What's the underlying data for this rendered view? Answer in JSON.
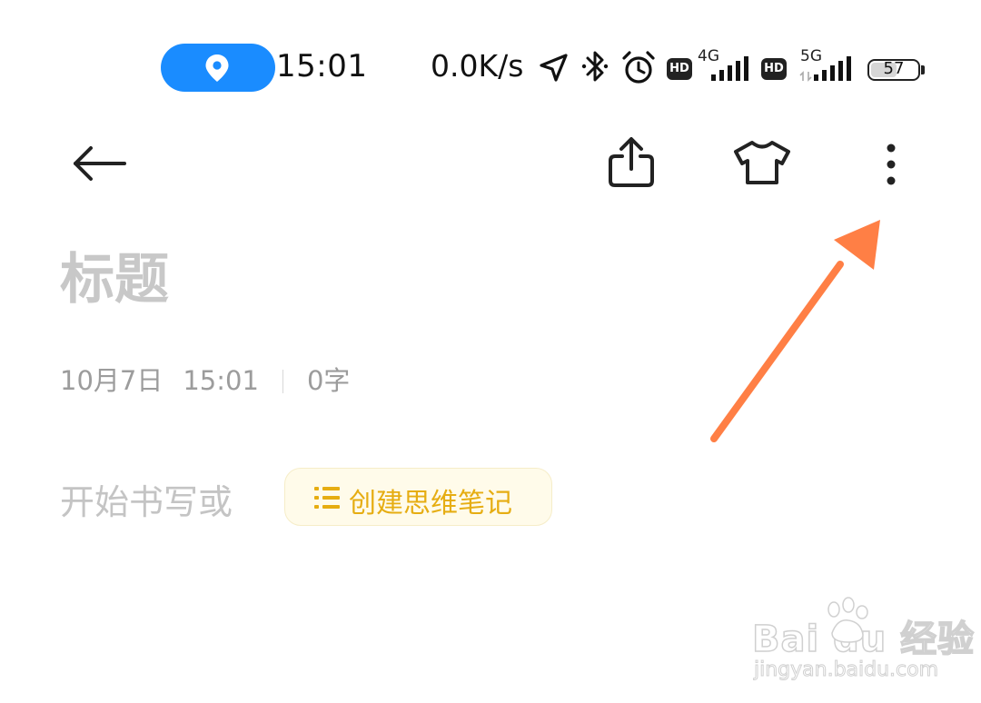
{
  "status_bar": {
    "time": "15:01",
    "net_speed": "0.0K/s",
    "sim1_badge": "HD",
    "sim1_network": "4G",
    "sim2_badge": "HD",
    "sim2_network": "5G",
    "battery_percent": "57",
    "battery_level": 57,
    "location_pill_color": "#1a8cff",
    "icons": [
      "location-pin-icon",
      "navigation-arrow-icon",
      "bluetooth-icon",
      "alarm-clock-icon",
      "signal-bars-icon",
      "battery-icon"
    ]
  },
  "toolbar": {
    "icons": [
      "back-arrow-icon",
      "share-icon",
      "tshirt-icon",
      "more-vertical-icon"
    ]
  },
  "note": {
    "title_placeholder": "标题",
    "date": "10月7日",
    "time": "15:01",
    "char_count": "0字",
    "body_placeholder": "开始书写或",
    "mind_note_button": "创建思维笔记",
    "accent_color": "#e6ad12"
  },
  "annotation": {
    "arrow_color": "#ff7f45"
  },
  "watermark": {
    "brand": "Bai du 经验",
    "url": "jingyan.baidu.com"
  }
}
